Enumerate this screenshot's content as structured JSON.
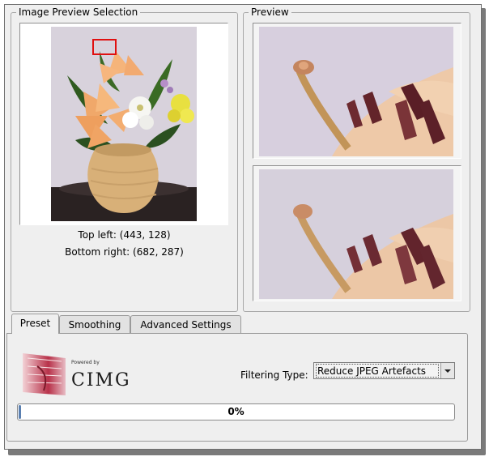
{
  "image_preview_selection": {
    "title": "Image Preview Selection",
    "top_left": "Top left: (443, 128)",
    "bottom_right": "Bottom right: (682, 287)"
  },
  "preview": {
    "title": "Preview"
  },
  "tabs": [
    {
      "label": "Preset",
      "active": true
    },
    {
      "label": "Smoothing",
      "active": false
    },
    {
      "label": "Advanced Settings",
      "active": false
    }
  ],
  "preset": {
    "logo_powered_by": "Powered by",
    "logo_name": "CIMG",
    "filtering_type_label": "Filtering Type:",
    "filtering_type_value": "Reduce JPEG Artefacts"
  },
  "progress": {
    "value": 0,
    "text": "0%"
  },
  "colors": {
    "progress_fill": "#5a7fb0",
    "selection_box": "#e01010",
    "window_bg": "#efefef"
  }
}
